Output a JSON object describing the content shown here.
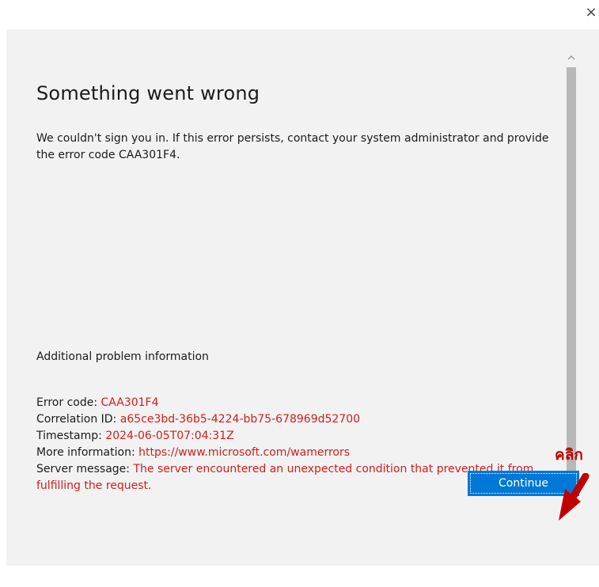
{
  "window": {
    "close_glyph": "×"
  },
  "dialog": {
    "title": "Something went wrong",
    "message": "We couldn't sign you in. If this error persists, contact your system administrator and provide the error code CAA301F4.",
    "additional_title": "Additional problem information",
    "details": {
      "error_code_label": "Error code: ",
      "error_code_value": "CAA301F4",
      "correlation_label": "Correlation ID: ",
      "correlation_value": "a65ce3bd-36b5-4224-bb75-678969d52700",
      "timestamp_label": "Timestamp: ",
      "timestamp_value": "2024-06-05T07:04:31Z",
      "more_info_label": "More information: ",
      "more_info_value": "https://www.microsoft.com/wamerrors",
      "server_message_label": "Server message: ",
      "server_message_value": "The server encountered an unexpected condition that prevented it from fulfilling the request."
    },
    "continue_label": "Continue"
  },
  "annotation": {
    "text": "คลิก"
  },
  "colors": {
    "accent": "#0078d7",
    "error_text": "#d11e1e",
    "annotation": "#c00000",
    "dialog_bg": "#f2f2f2"
  },
  "icons": {
    "close": "close-icon",
    "scroll_up": "chevron-up-icon",
    "arrow": "arrow-icon"
  }
}
